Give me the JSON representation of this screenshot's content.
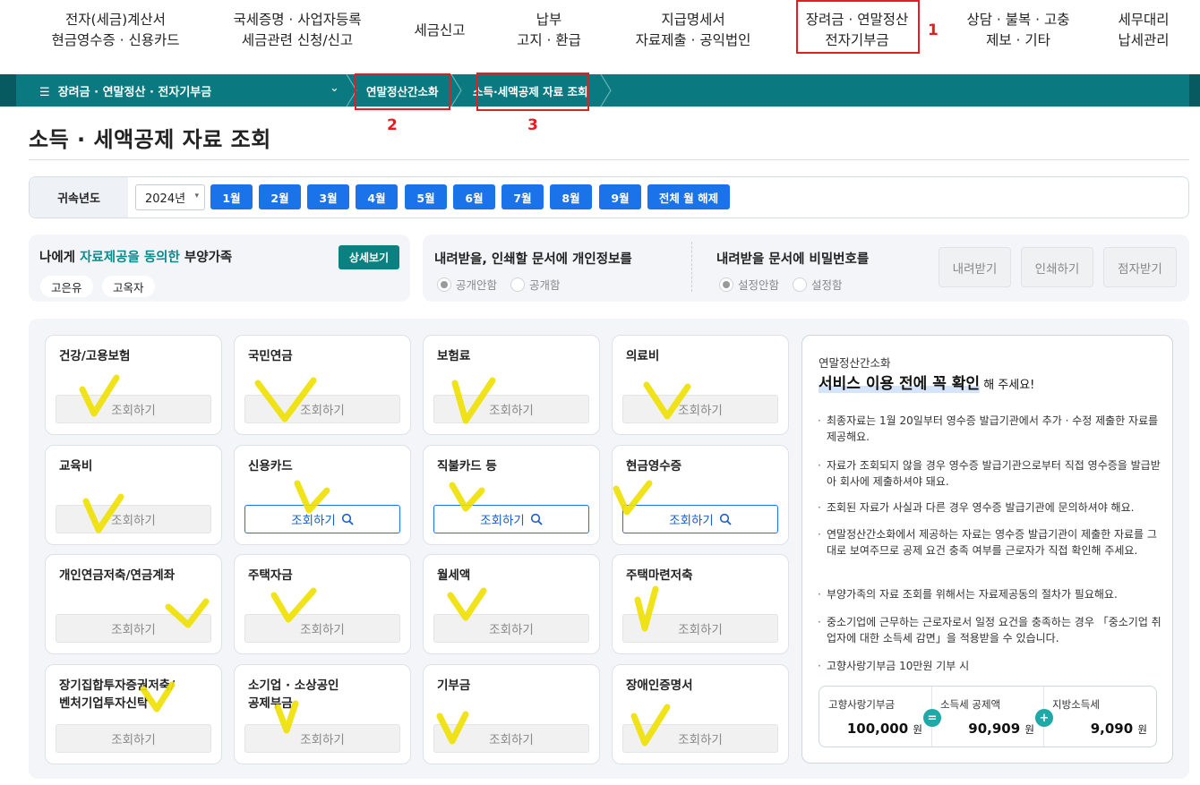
{
  "top_nav": [
    {
      "line1": "전자(세금)계산서",
      "line2": "현금영수증 · 신용카드"
    },
    {
      "line1": "국세증명 · 사업자등록",
      "line2": "세금관련 신청/신고"
    },
    {
      "line1": "세금신고",
      "line2": ""
    },
    {
      "line1": "납부",
      "line2": "고지 · 환급"
    },
    {
      "line1": "지급명세서",
      "line2": "자료제출 · 공익법인"
    },
    {
      "line1": "장려금 · 연말정산",
      "line2": "전자기부금"
    },
    {
      "line1": "상담 · 불복 · 고충",
      "line2": "제보 · 기타"
    },
    {
      "line1": "세무대리",
      "line2": "납세관리"
    }
  ],
  "annotations": [
    "1",
    "2",
    "3"
  ],
  "breadcrumb": {
    "menu_icon": "☰",
    "menu_label": "장려금 · 연말정산 · 전자기부금",
    "chevron": "⌄",
    "items": [
      "연말정산간소화",
      "소득·세액공제 자료 조회"
    ]
  },
  "page_title": "소득 · 세액공제 자료 조회",
  "year_filter": {
    "label": "귀속년도",
    "selected_year": "2024년",
    "months": [
      "1월",
      "2월",
      "3월",
      "4월",
      "5월",
      "6월",
      "7월",
      "8월",
      "9월"
    ],
    "clear_all": "전체 월 해제"
  },
  "dependents": {
    "title_pre": "나에게 ",
    "title_hl": "자료제공을 동의한",
    "title_post": " 부양가족",
    "detail_button": "상세보기",
    "names": [
      "고은유",
      "고옥자"
    ]
  },
  "privacy_option": {
    "title": "내려받을, 인쇄할 문서에 개인정보를",
    "options": [
      "공개안함",
      "공개함"
    ],
    "selected": 0
  },
  "password_option": {
    "title": "내려받을 문서에 비밀번호를",
    "options": [
      "설정안함",
      "설정함"
    ],
    "selected": 0
  },
  "action_buttons": [
    "내려받기",
    "인쇄하기",
    "점자받기"
  ],
  "cards": [
    {
      "title": "건강/고용보험",
      "button": "조회하기",
      "enabled": false
    },
    {
      "title": "국민연금",
      "button": "조회하기",
      "enabled": false
    },
    {
      "title": "보험료",
      "button": "조회하기",
      "enabled": false
    },
    {
      "title": "의료비",
      "button": "조회하기",
      "enabled": false
    },
    {
      "title": "교육비",
      "button": "조회하기",
      "enabled": false
    },
    {
      "title": "신용카드",
      "button": "조회하기",
      "enabled": true
    },
    {
      "title": "직불카드 등",
      "button": "조회하기",
      "enabled": true
    },
    {
      "title": "현금영수증",
      "button": "조회하기",
      "enabled": true
    },
    {
      "title": "개인연금저축/연금계좌",
      "button": "조회하기",
      "enabled": false
    },
    {
      "title": "주택자금",
      "button": "조회하기",
      "enabled": false
    },
    {
      "title": "월세액",
      "button": "조회하기",
      "enabled": false
    },
    {
      "title": "주택마련저축",
      "button": "조회하기",
      "enabled": false
    },
    {
      "title": "장기집합투자증권저축/\n벤처기업투자신탁",
      "button": "조회하기",
      "enabled": false
    },
    {
      "title": "소기업 · 소상공인\n공제부금",
      "button": "조회하기",
      "enabled": false
    },
    {
      "title": "기부금",
      "button": "조회하기",
      "enabled": false
    },
    {
      "title": "장애인증명서",
      "button": "조회하기",
      "enabled": false
    }
  ],
  "info_box": {
    "subtitle": "연말정산간소화",
    "headline": "서비스 이용 전에 꼭 확인",
    "headline_tail": " 해 주세요!",
    "bullets": [
      "최종자료는 1월 20일부터 영수증 발급기관에서 추가 · 수정 제출한 자료를 제공해요.",
      "자료가 조회되지 않을 경우 영수증 발급기관으로부터 직접 영수증을 발급받아 회사에 제출하셔야 돼요.",
      "조회된 자료가 사실과 다른 경우 영수증 발급기관에 문의하셔야 해요.",
      "연말정산간소화에서 제공하는 자료는 영수증 발급기관이 제출한 자료를 그대로 보여주므로 공제 요건 충족 여부를 근로자가 직접 확인해 주세요.",
      "부양가족의 자료 조회를 위해서는 자료제공동의 절차가 필요해요.",
      "중소기업에 근무하는 근로자로서 일정 요건을 충족하는 경우 「중소기업 취업자에 대한 소득세 감면」을 적용받을 수 있습니다.",
      "고향사랑기부금 10만원 기부 시"
    ],
    "calc": [
      {
        "label": "고향사랑기부금",
        "value": "100,000",
        "unit": "원"
      },
      {
        "label": "소득세 공제액",
        "value": "90,909",
        "unit": "원"
      },
      {
        "label": "지방소득세",
        "value": "9,090",
        "unit": "원"
      }
    ],
    "ops": [
      "=",
      "+"
    ]
  },
  "colors": {
    "teal": "#0b7a80",
    "blue": "#1a73e8",
    "red": "#e41e1e",
    "highlighter": "#f0e000"
  }
}
